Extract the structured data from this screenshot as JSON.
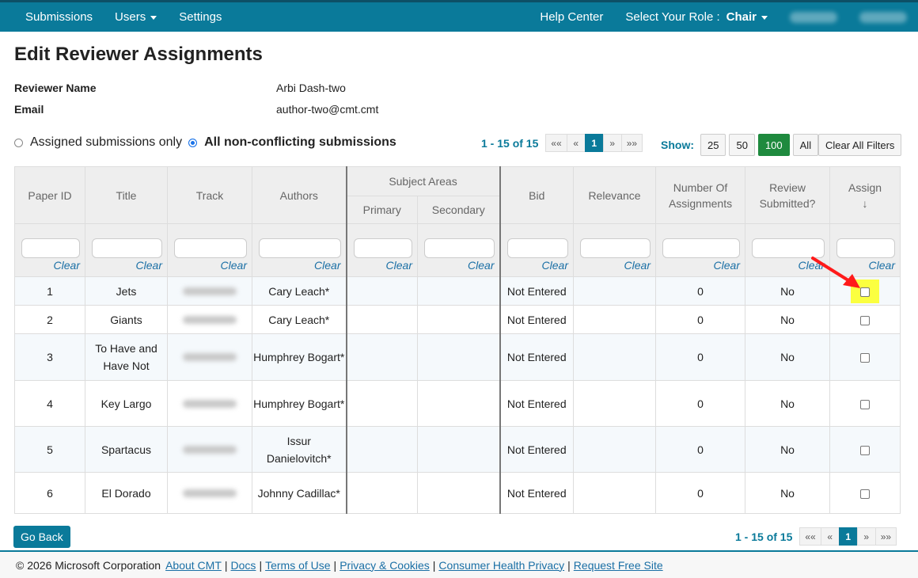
{
  "navbar": {
    "left": [
      {
        "label": "Submissions",
        "caret": false
      },
      {
        "label": "Users",
        "caret": true
      },
      {
        "label": "Settings",
        "caret": false
      }
    ],
    "help": "Help Center",
    "role_label": "Select Your Role :",
    "role_value": "Chair"
  },
  "page": {
    "title": "Edit Reviewer Assignments",
    "reviewer_name_label": "Reviewer Name",
    "reviewer_name": "Arbi Dash-two",
    "email_label": "Email",
    "email": "author-two@cmt.cmt"
  },
  "filter_options": {
    "assigned_only": "Assigned submissions only",
    "all_non_conflicting": "All non-conflicting submissions",
    "selected": "all_non_conflicting"
  },
  "pager": {
    "count_text": "1 - 15 of 15",
    "first": "««",
    "prev": "«",
    "current": "1",
    "next": "»",
    "last": "»»"
  },
  "show": {
    "label": "Show:",
    "options": [
      "25",
      "50",
      "100",
      "All"
    ],
    "selected": "100"
  },
  "clear_all_filters": "Clear All Filters",
  "table": {
    "headers": {
      "paper_id": "Paper ID",
      "title": "Title",
      "track": "Track",
      "authors": "Authors",
      "subject_areas": "Subject Areas",
      "primary": "Primary",
      "secondary": "Secondary",
      "bid": "Bid",
      "relevance": "Relevance",
      "num_assignments": "Number Of Assignments",
      "review_submitted": "Review Submitted?",
      "assign": "Assign",
      "assign_sort": "↓"
    },
    "clear_label": "Clear",
    "rows": [
      {
        "id": "1",
        "title": "Jets",
        "authors": "Cary Leach*",
        "bid": "Not Entered",
        "assignments": "0",
        "submitted": "No"
      },
      {
        "id": "2",
        "title": "Giants",
        "authors": "Cary Leach*",
        "bid": "Not Entered",
        "assignments": "0",
        "submitted": "No"
      },
      {
        "id": "3",
        "title": "To Have and Have Not",
        "authors": "Humphrey Bogart*",
        "bid": "Not Entered",
        "assignments": "0",
        "submitted": "No"
      },
      {
        "id": "4",
        "title": "Key Largo",
        "authors": "Humphrey Bogart*",
        "bid": "Not Entered",
        "assignments": "0",
        "submitted": "No"
      },
      {
        "id": "5",
        "title": "Spartacus",
        "authors": "Issur Danielovitch*",
        "bid": "Not Entered",
        "assignments": "0",
        "submitted": "No"
      },
      {
        "id": "6",
        "title": "El Dorado",
        "authors": "Johnny Cadillac*",
        "bid": "Not Entered",
        "assignments": "0",
        "submitted": "No"
      }
    ]
  },
  "go_back": "Go Back",
  "footer": {
    "copyright": "© 2026 Microsoft Corporation",
    "links": [
      "About CMT",
      "Docs",
      "Terms of Use",
      "Privacy & Cookies",
      "Consumer Health Privacy",
      "Request Free Site"
    ]
  },
  "colors": {
    "brand": "#0a7a9a",
    "active_show": "#1e8a3e",
    "highlight": "#fbff40",
    "annotation_arrow": "#ff1a1a"
  }
}
